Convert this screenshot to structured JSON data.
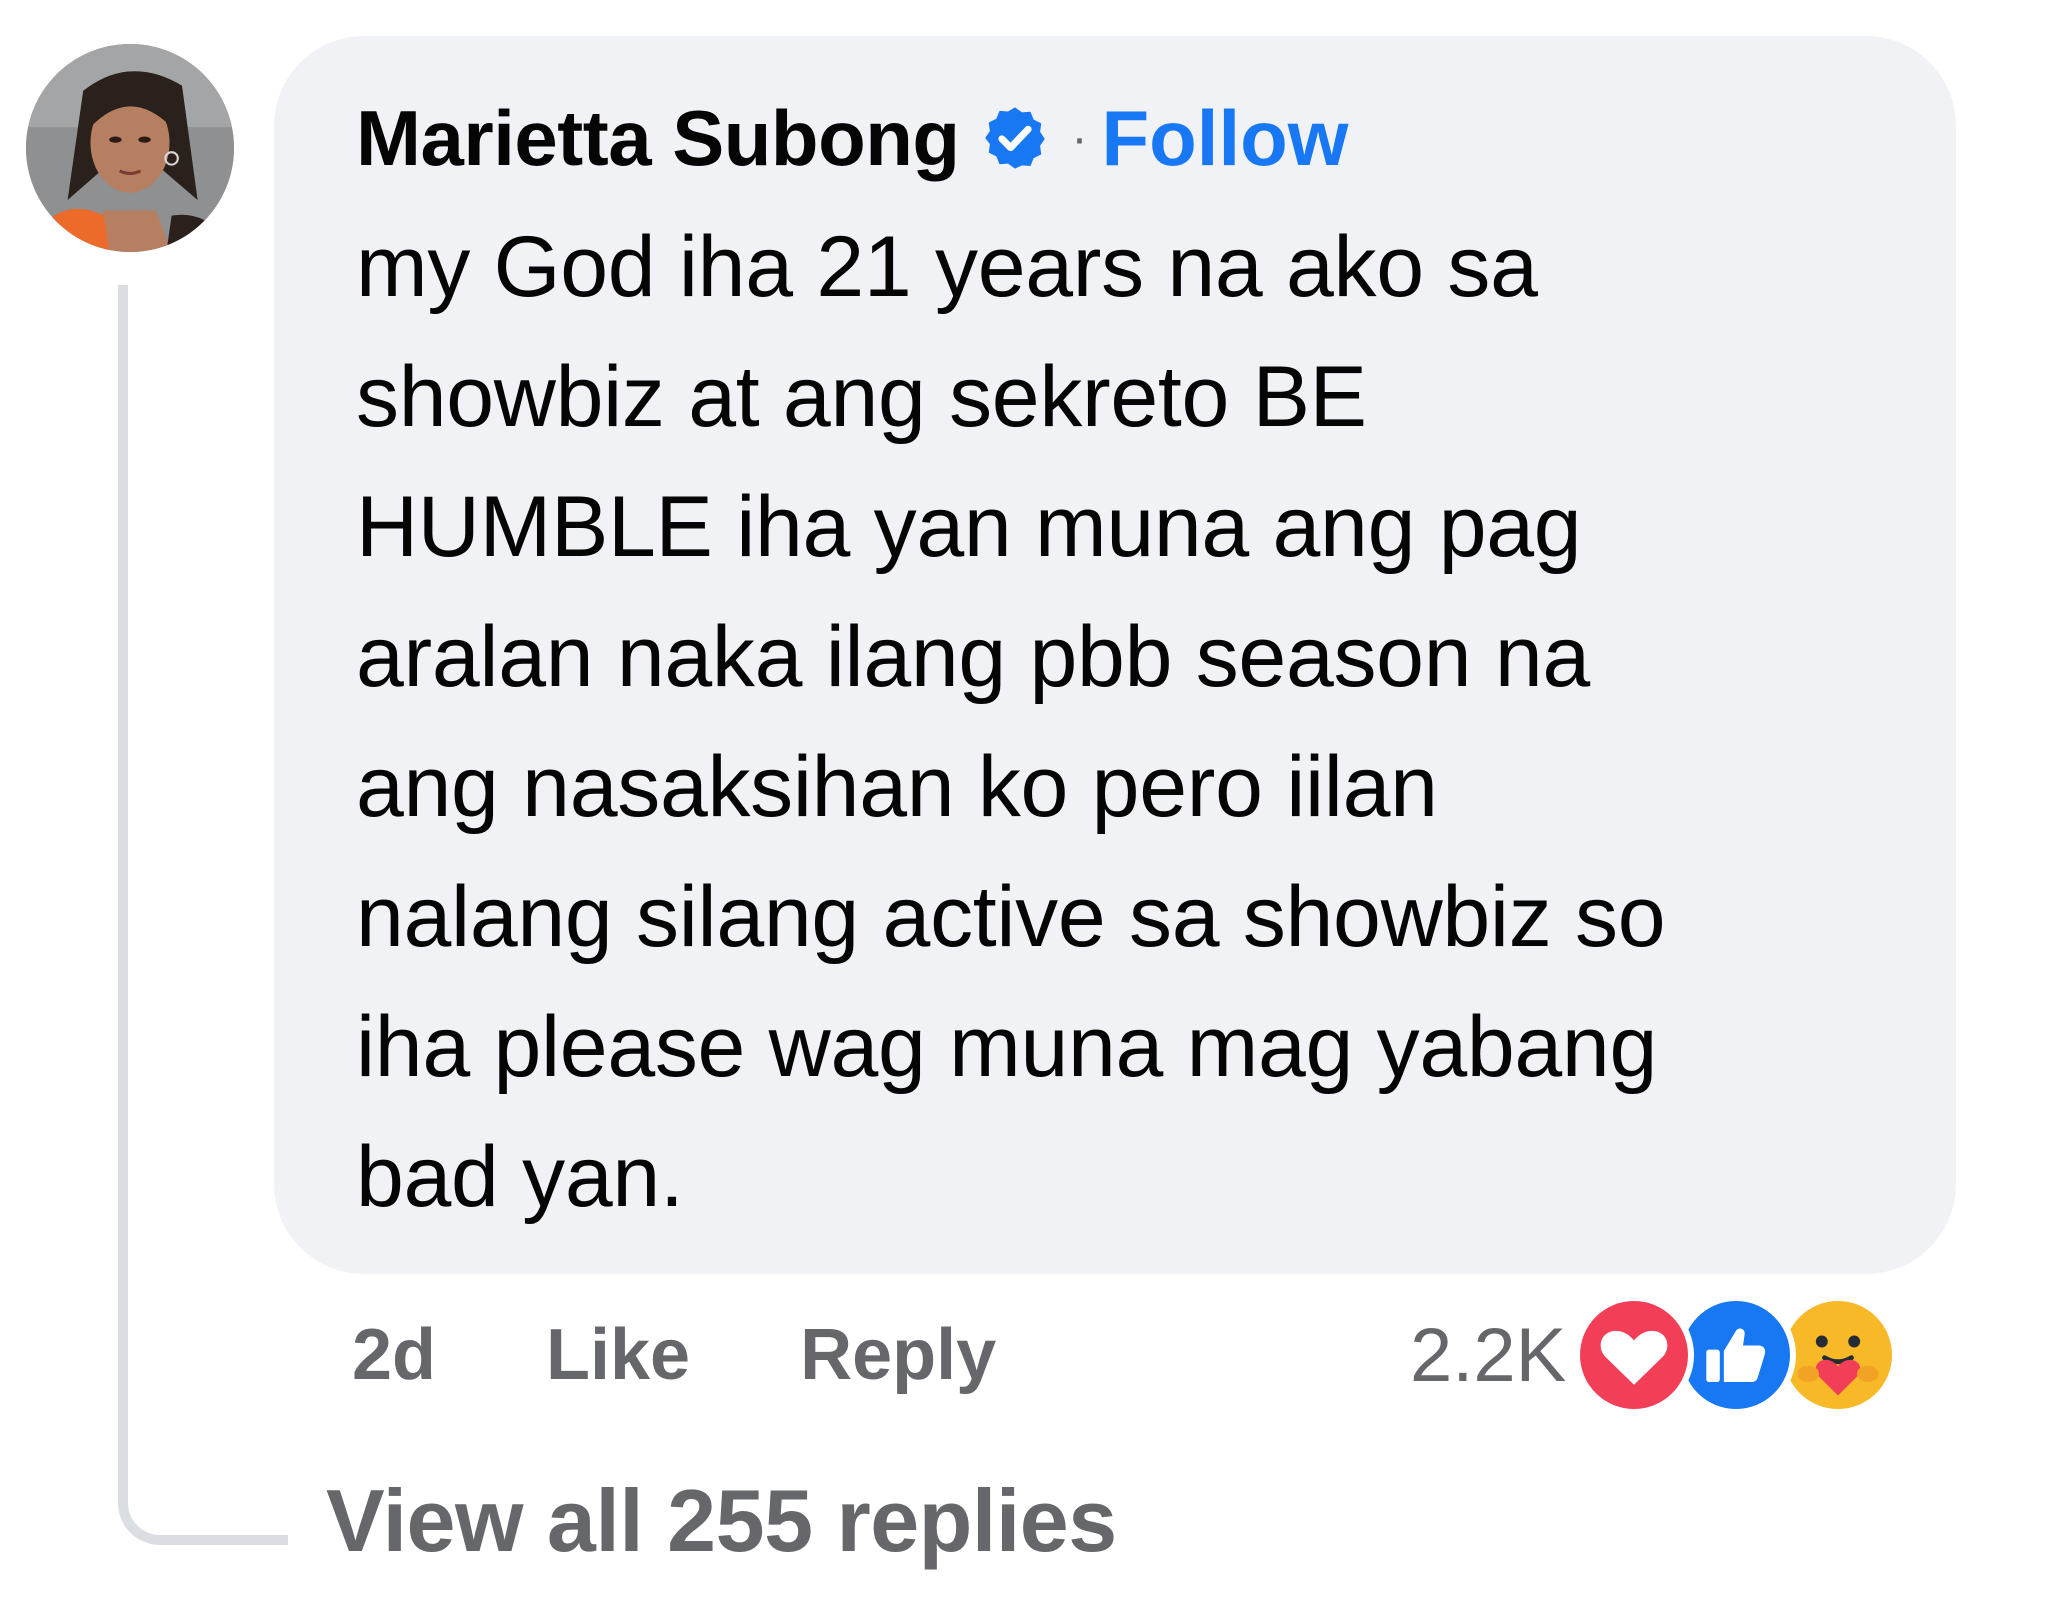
{
  "comment": {
    "author": "Marietta Subong",
    "separator": "·",
    "follow_label": "Follow",
    "text": "my God iha 21 years na ako sa\nshowbiz at ang sekreto BE\nHUMBLE iha yan muna ang pag\naralan naka ilang pbb season na\nang nasaksihan ko pero iilan\nnalang silang active sa showbiz so\niha please wag muna mag yabang\nbad yan.",
    "timestamp": "2d",
    "like_label": "Like",
    "reply_label": "Reply",
    "reaction_count": "2.2K",
    "reactions": [
      "love-reaction-icon",
      "like-reaction-icon",
      "care-reaction-icon"
    ],
    "view_replies_label": "View all 255 replies"
  },
  "colors": {
    "bubble_bg": "#f0f2f5",
    "link_blue": "#1877f2",
    "secondary_text": "#65676b",
    "thread_line": "#dadde1",
    "love_red": "#f33e58",
    "like_blue": "#1877f2",
    "care_yellow": "#f7b928"
  }
}
